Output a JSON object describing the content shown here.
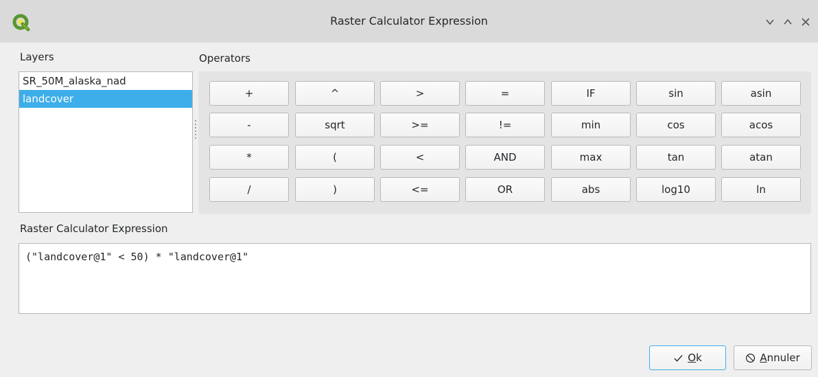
{
  "window": {
    "title": "Raster Calculator Expression",
    "logo_icon": "qgis-logo-icon",
    "buttons": [
      "minimize-icon",
      "maximize-icon",
      "close-icon"
    ]
  },
  "layers": {
    "label": "Layers",
    "items": [
      {
        "name": "SR_50M_alaska_nad",
        "selected": false
      },
      {
        "name": "landcover",
        "selected": true
      }
    ]
  },
  "operators": {
    "label": "Operators",
    "rows": [
      [
        "+",
        "^",
        ">",
        "=",
        "IF",
        "sin",
        "asin"
      ],
      [
        "-",
        "sqrt",
        ">=",
        "!=",
        "min",
        "cos",
        "acos"
      ],
      [
        "*",
        "(",
        "<",
        "AND",
        "max",
        "tan",
        "atan"
      ],
      [
        "/",
        ")",
        "<=",
        "OR",
        "abs",
        "log10",
        "ln"
      ]
    ]
  },
  "expression": {
    "label": "Raster Calculator Expression",
    "value": "(\"landcover@1\" < 50) * \"landcover@1\""
  },
  "footer": {
    "ok": {
      "mnemonic": "O",
      "rest": "k",
      "icon": "checkmark-icon"
    },
    "cancel": {
      "mnemonic": "A",
      "rest": "nnuler",
      "icon": "cancel-circle-icon"
    }
  },
  "colors": {
    "selection": "#3daee9",
    "accent_logo": "#589632"
  }
}
